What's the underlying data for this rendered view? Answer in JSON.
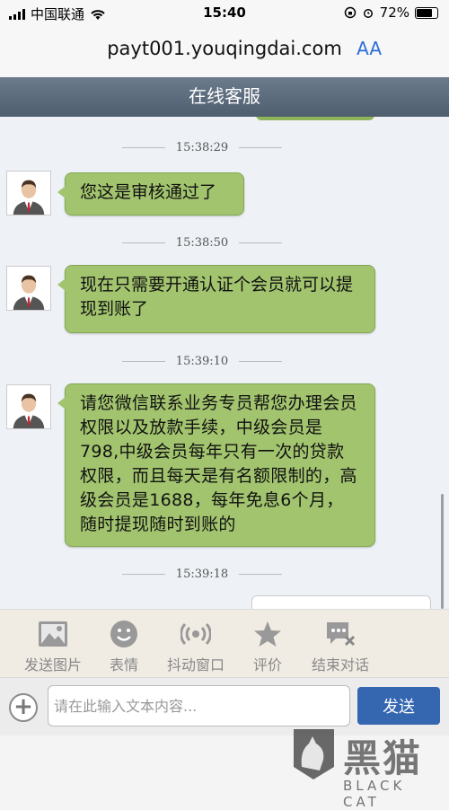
{
  "status_bar": {
    "carrier": "中国联通",
    "time": "15:40",
    "battery": "72%"
  },
  "browser": {
    "url": "payt001.youqingdai.com",
    "text_size_button": "AA"
  },
  "header": {
    "title": "在线客服"
  },
  "messages": [
    {
      "timestamp": "15:38:29",
      "text": "您这是审核通过了"
    },
    {
      "timestamp": "15:38:50",
      "text": "现在只需要开通认证个会员就可以提现到账了"
    },
    {
      "timestamp": "15:39:10",
      "text": "请您微信联系业务专员帮您办理会员权限以及放款手续，中级会员是798,中级会员每年只有一次的贷款权限，而且每天是有名额限制的，高级会员是1688，每年免息6个月，随时提现随时到账的"
    },
    {
      "timestamp": "15:39:18",
      "text": ""
    }
  ],
  "toolbar": {
    "items": [
      {
        "label": "发送图片",
        "icon": "image-icon"
      },
      {
        "label": "表情",
        "icon": "smiley-icon"
      },
      {
        "label": "抖动窗口",
        "icon": "vibrate-icon"
      },
      {
        "label": "评价",
        "icon": "star-icon"
      },
      {
        "label": "结束对话",
        "icon": "end-chat-icon"
      }
    ]
  },
  "composer": {
    "placeholder": "请在此输入文本内容...",
    "value": "",
    "send_label": "发送"
  },
  "watermark": {
    "cn": "黑猫",
    "en": "BLACK CAT"
  },
  "colors": {
    "bubble": "#a2c46e",
    "header": "#5a6a7b",
    "send_button": "#3566b0"
  }
}
